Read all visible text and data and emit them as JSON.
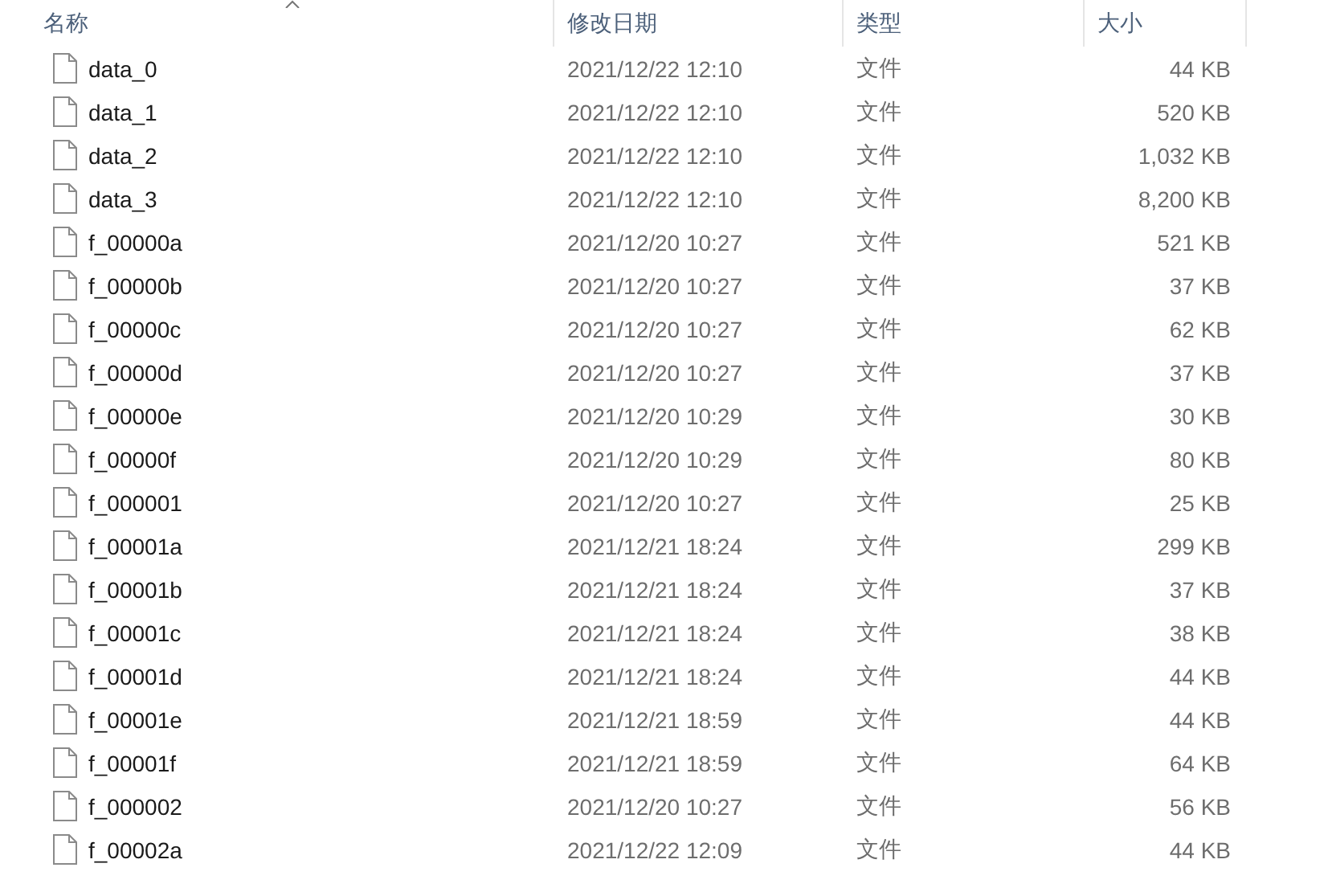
{
  "columns": [
    {
      "label": "名称"
    },
    {
      "label": "修改日期"
    },
    {
      "label": "类型"
    },
    {
      "label": "大小"
    }
  ],
  "rows": [
    {
      "name": "data_0",
      "modified": "2021/12/22 12:10",
      "type": "文件",
      "size": "44 KB"
    },
    {
      "name": "data_1",
      "modified": "2021/12/22 12:10",
      "type": "文件",
      "size": "520 KB"
    },
    {
      "name": "data_2",
      "modified": "2021/12/22 12:10",
      "type": "文件",
      "size": "1,032 KB"
    },
    {
      "name": "data_3",
      "modified": "2021/12/22 12:10",
      "type": "文件",
      "size": "8,200 KB"
    },
    {
      "name": "f_00000a",
      "modified": "2021/12/20 10:27",
      "type": "文件",
      "size": "521 KB"
    },
    {
      "name": "f_00000b",
      "modified": "2021/12/20 10:27",
      "type": "文件",
      "size": "37 KB"
    },
    {
      "name": "f_00000c",
      "modified": "2021/12/20 10:27",
      "type": "文件",
      "size": "62 KB"
    },
    {
      "name": "f_00000d",
      "modified": "2021/12/20 10:27",
      "type": "文件",
      "size": "37 KB"
    },
    {
      "name": "f_00000e",
      "modified": "2021/12/20 10:29",
      "type": "文件",
      "size": "30 KB"
    },
    {
      "name": "f_00000f",
      "modified": "2021/12/20 10:29",
      "type": "文件",
      "size": "80 KB"
    },
    {
      "name": "f_000001",
      "modified": "2021/12/20 10:27",
      "type": "文件",
      "size": "25 KB"
    },
    {
      "name": "f_00001a",
      "modified": "2021/12/21 18:24",
      "type": "文件",
      "size": "299 KB"
    },
    {
      "name": "f_00001b",
      "modified": "2021/12/21 18:24",
      "type": "文件",
      "size": "37 KB"
    },
    {
      "name": "f_00001c",
      "modified": "2021/12/21 18:24",
      "type": "文件",
      "size": "38 KB"
    },
    {
      "name": "f_00001d",
      "modified": "2021/12/21 18:24",
      "type": "文件",
      "size": "44 KB"
    },
    {
      "name": "f_00001e",
      "modified": "2021/12/21 18:59",
      "type": "文件",
      "size": "44 KB"
    },
    {
      "name": "f_00001f",
      "modified": "2021/12/21 18:59",
      "type": "文件",
      "size": "64 KB"
    },
    {
      "name": "f_000002",
      "modified": "2021/12/20 10:27",
      "type": "文件",
      "size": "56 KB"
    },
    {
      "name": "f_00002a",
      "modified": "2021/12/22 12:09",
      "type": "文件",
      "size": "44 KB"
    }
  ]
}
